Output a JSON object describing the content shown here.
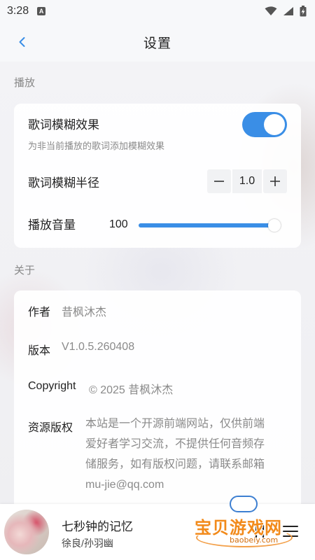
{
  "status_bar": {
    "time": "3:28",
    "notification_icon": "A"
  },
  "header": {
    "title": "设置",
    "back_icon": "chevron-left-icon"
  },
  "playback_section": {
    "label": "播放",
    "lyric_blur": {
      "title": "歌词模糊效果",
      "description": "为非当前播放的歌词添加模糊效果",
      "enabled": true
    },
    "blur_radius": {
      "title": "歌词模糊半径",
      "value": "1.0",
      "minus_label": "−",
      "plus_label": "+"
    },
    "volume": {
      "title": "播放音量",
      "value": "100",
      "level": 1.0
    }
  },
  "about_section": {
    "label": "关于",
    "author_label": "作者",
    "author_value": "昔枫沐杰",
    "version_label": "版本",
    "version_value": "V1.0.5.260408",
    "copyright_label": "Copyright",
    "copyright_value": "© 2025 昔枫沐杰",
    "rights_label": "资源版权",
    "rights_lines": [
      "本站是一个开源前端网站，仅供前端",
      "爱好者学习交流，不提供任何音频存",
      "储服务，如有版权问题，请联系邮箱",
      "mu-jie@qq.com"
    ]
  },
  "player": {
    "song_title": "七秒钟的记忆",
    "artist": "徐良/孙羽幽"
  },
  "watermark": {
    "text": "宝贝游戏网",
    "url": "baobeiy.com"
  },
  "colors": {
    "accent": "#3a8ee6",
    "background": "#f2f3f5",
    "card": "#ffffff",
    "watermark": "#f28a1a"
  }
}
